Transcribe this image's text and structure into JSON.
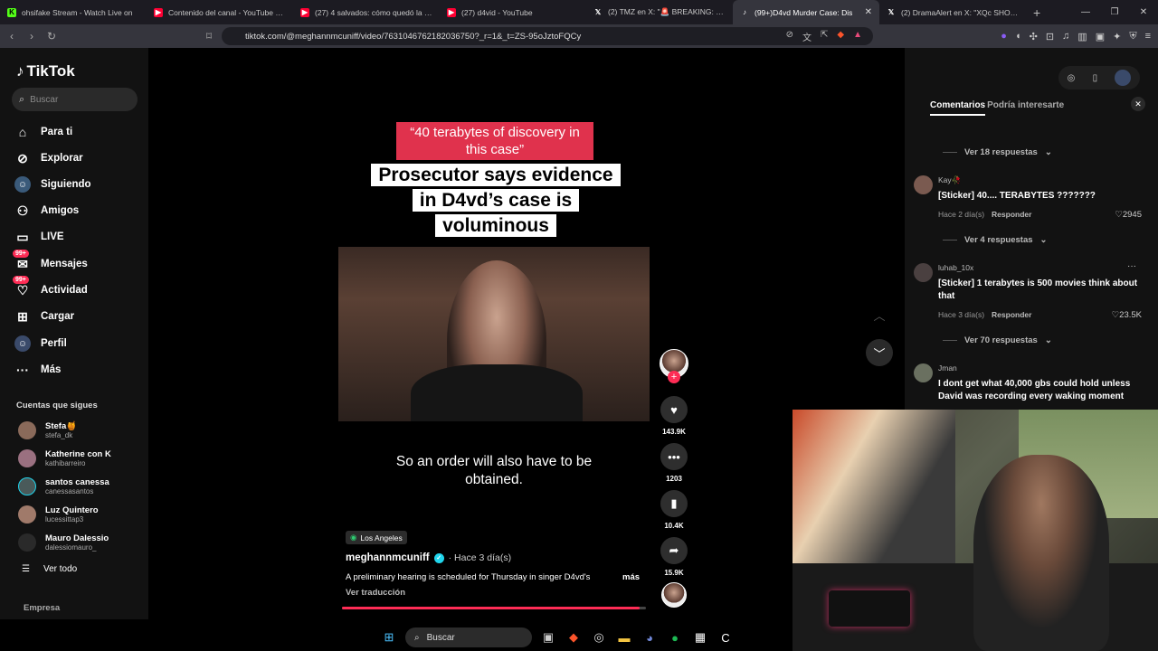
{
  "browser": {
    "tabs": [
      {
        "title": "ohsifake Stream - Watch Live on",
        "icon": "kick-icon",
        "color": "#53fc18"
      },
      {
        "title": "Contenido del canal - YouTube Studi",
        "icon": "youtube-icon",
        "color": "#ff0033"
      },
      {
        "title": "(27) 4 salvados: cómo quedó la placa",
        "icon": "youtube-icon",
        "color": "#ff0033"
      },
      {
        "title": "(27) d4vid - YouTube",
        "icon": "youtube-icon",
        "color": "#ff0033"
      },
      {
        "title": "(2) TMZ en X: \"🚨 BREAKING: D4vd",
        "icon": "x-icon",
        "color": "#ffffff"
      },
      {
        "title": "(99+)D4vd Murder Case: Dis",
        "icon": "tiktok-icon",
        "color": "#ffffff",
        "active": true
      },
      {
        "title": "(2) DramaAlert en X: \"XQc SHOCKED",
        "icon": "x-icon",
        "color": "#ffffff"
      }
    ],
    "url": "tiktok.com/@meghannmcuniff/video/7631046762182036750?_r=1&_t=ZS-95oJztoFQCy"
  },
  "sidebar": {
    "logo": "TikTok",
    "search_placeholder": "Buscar",
    "items": [
      {
        "label": "Para ti",
        "icon": "home-icon"
      },
      {
        "label": "Explorar",
        "icon": "compass-icon"
      },
      {
        "label": "Siguiendo",
        "icon": "following-icon"
      },
      {
        "label": "Amigos",
        "icon": "friends-icon"
      },
      {
        "label": "LIVE",
        "icon": "live-icon"
      },
      {
        "label": "Mensajes",
        "icon": "messages-icon",
        "badge": "99+"
      },
      {
        "label": "Actividad",
        "icon": "activity-icon",
        "badge": "99+"
      },
      {
        "label": "Cargar",
        "icon": "upload-icon"
      },
      {
        "label": "Perfil",
        "icon": "profile-icon"
      },
      {
        "label": "Más",
        "icon": "more-icon"
      }
    ],
    "following_heading": "Cuentas que sigues",
    "following": [
      {
        "name": "Stefa🍯",
        "handle": "stefa_dk"
      },
      {
        "name": "Katherine con K",
        "handle": "kathibarreiro"
      },
      {
        "name": "santos canessa",
        "handle": "canessasantos"
      },
      {
        "name": "Luz Quintero",
        "handle": "lucessittap3"
      },
      {
        "name": "Mauro Dalessio",
        "handle": "dalessiomauro_"
      }
    ],
    "see_all": "Ver todo",
    "footer": "Empresa"
  },
  "video": {
    "caption_top": "“40 terabytes of discovery in this case”",
    "caption_main": "Prosecutor says evidence in D4vd’s case is voluminous",
    "subtitle": "So an order will also have to be obtained.",
    "location": "Los Angeles",
    "author": "meghannmcuniff",
    "time": "· Hace 3 día(s)",
    "description": "A preliminary hearing is scheduled for Thursday in singer D4vd's",
    "more": "más",
    "translate": "Ver traducción",
    "progress": 0.98
  },
  "actions": {
    "likes": "143.9K",
    "comments": "1203",
    "saves": "10.4K",
    "shares": "15.9K"
  },
  "comments_panel": {
    "tab_active": "Comentarios",
    "tab_other": "Podría interesarte",
    "comments": [
      {
        "replies_before": "Ver 18 respuestas",
        "user": "Kay🥀",
        "text": "[Sticker] 40.... TERABYTES ???????",
        "time": "Hace 2 día(s)",
        "reply": "Responder",
        "likes": "2945"
      },
      {
        "replies_before": "Ver 4 respuestas",
        "user": "luhab_10x",
        "text": "[Sticker] 1 terabytes is 500 movies think about that",
        "time": "Hace 3 día(s)",
        "reply": "Responder",
        "likes": "23.5K"
      },
      {
        "replies_before": "Ver 70 respuestas",
        "user": "Jman",
        "text": "I dont get what 40,000 gbs could hold unless David was recording every waking moment"
      }
    ]
  },
  "taskbar": {
    "search": "Buscar"
  }
}
